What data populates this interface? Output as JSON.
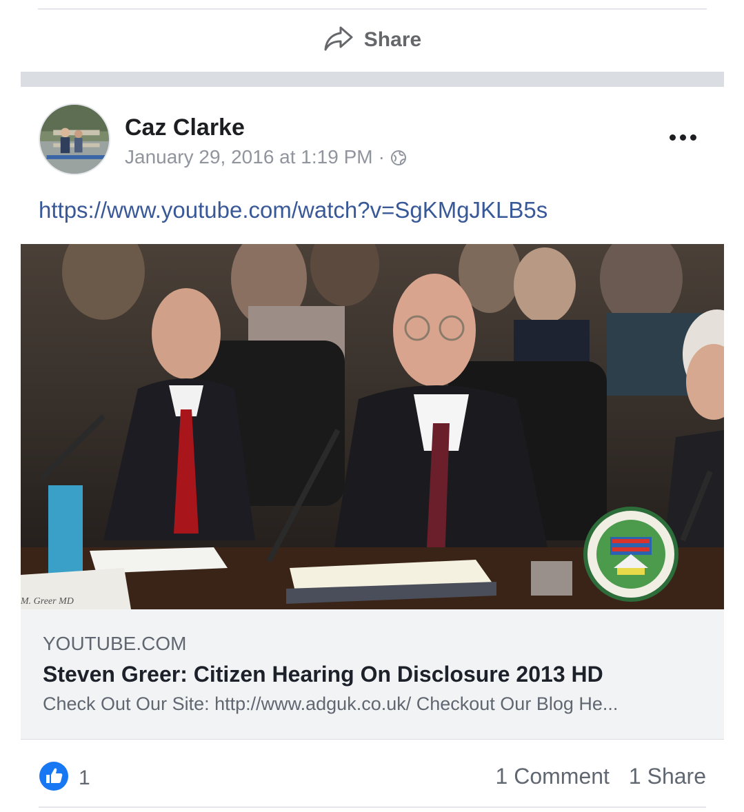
{
  "top_actions": {
    "share_label": "Share"
  },
  "post": {
    "author": "Caz Clarke",
    "timestamp": "January 29, 2016 at 1:19 PM",
    "separator": "·",
    "privacy_icon": "globe-icon",
    "more_icon": "more-options-icon",
    "link_text": "https://www.youtube.com/watch?v=SgKMgJKLB5s"
  },
  "link_preview": {
    "nameplate": "M. Greer MD",
    "domain": "YOUTUBE.COM",
    "title": "Steven Greer: Citizen Hearing On Disclosure 2013 HD",
    "description": "Check Out Our Site: http://www.adguk.co.uk/ Checkout Our Blog He..."
  },
  "footer": {
    "like_icon": "thumbs-up-icon",
    "like_count": "1",
    "comments": "1 Comment",
    "shares": "1 Share"
  },
  "colors": {
    "link": "#385898",
    "like_blue": "#1877f2",
    "meta_gray": "#90949c",
    "band_gray": "#dadde1"
  }
}
